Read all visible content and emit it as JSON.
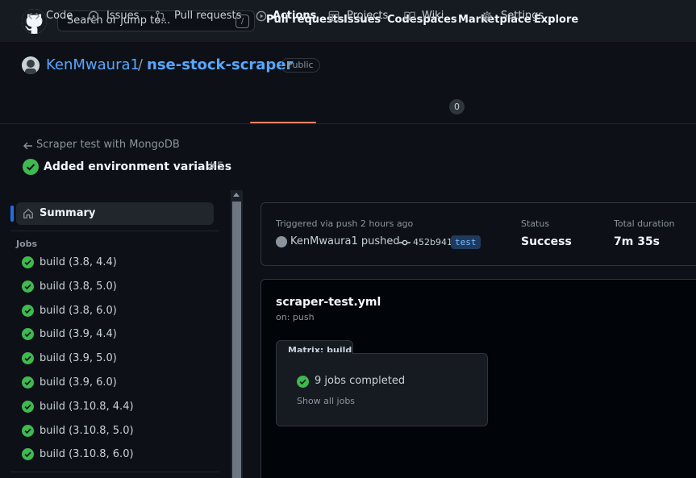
{
  "header": {
    "search_placeholder": "Search or jump to...",
    "search_shortcut": "/",
    "nav": [
      "Pull requests",
      "Issues",
      "Codespaces",
      "Marketplace",
      "Explore"
    ]
  },
  "repo": {
    "owner": "KenMwaura1",
    "separator": "/",
    "name": "nse-stock-scraper",
    "visibility": "Public"
  },
  "tabs": [
    {
      "label": "Code",
      "icon": "code-icon"
    },
    {
      "label": "Issues",
      "icon": "issue-icon"
    },
    {
      "label": "Pull requests",
      "icon": "pull-request-icon"
    },
    {
      "label": "Actions",
      "icon": "play-icon",
      "active": true
    },
    {
      "label": "Projects",
      "icon": "table-icon"
    },
    {
      "label": "Wiki",
      "icon": "book-icon",
      "count": "0"
    },
    {
      "label": "Settings",
      "icon": "gear-icon"
    }
  ],
  "run": {
    "back_label": "Scraper test with MongoDB",
    "title": "Added environment variables",
    "number": "#5"
  },
  "sidebar": {
    "summary_label": "Summary",
    "jobs_heading": "Jobs",
    "jobs": [
      "build (3.8, 4.4)",
      "build (3.8, 5.0)",
      "build (3.8, 6.0)",
      "build (3.9, 4.4)",
      "build (3.9, 5.0)",
      "build (3.9, 6.0)",
      "build (3.10.8, 4.4)",
      "build (3.10.8, 5.0)",
      "build (3.10.8, 6.0)"
    ]
  },
  "trigger": {
    "triggered_text": "Triggered via push 2 hours ago",
    "actor_text": "KenMwaura1 pushed",
    "commit": "452b941",
    "branch": "test",
    "status_label": "Status",
    "status_value": "Success",
    "duration_label": "Total duration",
    "duration_value": "7m 35s"
  },
  "workflow": {
    "file": "scraper-test.yml",
    "on": "on: push",
    "matrix_label": "Matrix: build",
    "jobs_completed": "9 jobs completed",
    "show_all": "Show all jobs"
  },
  "colors": {
    "success": "#3fb950",
    "link": "#58a6ff",
    "active_tab": "#f78166"
  }
}
